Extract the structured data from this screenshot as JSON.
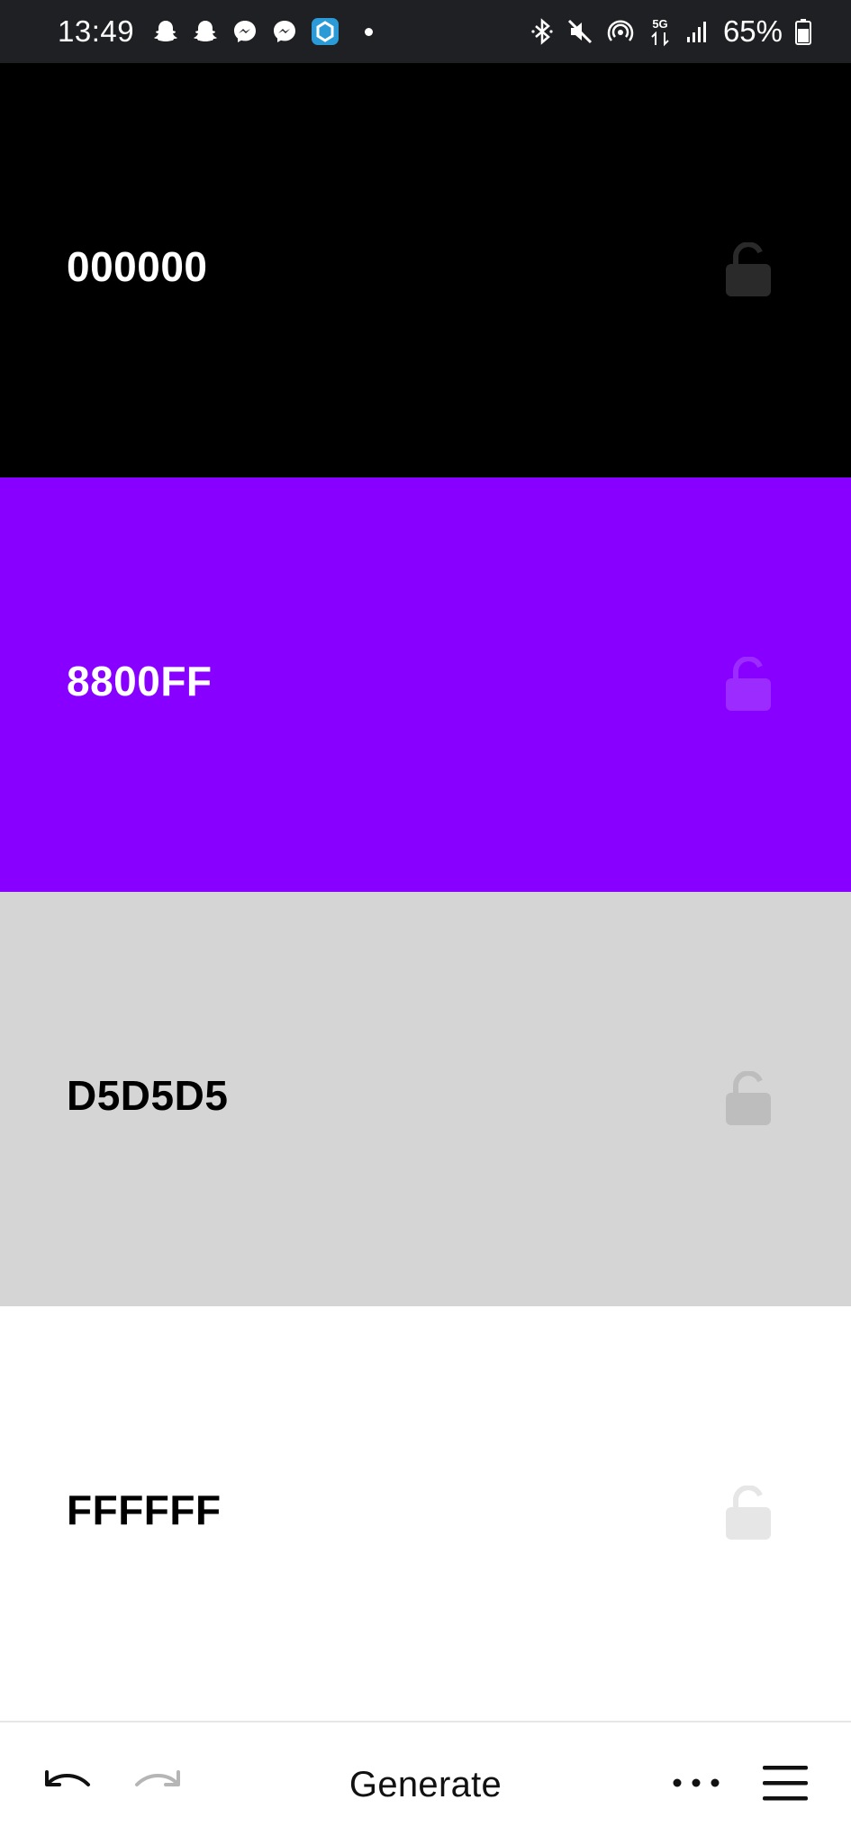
{
  "status_bar": {
    "time": "13:49",
    "left_icons": [
      "snapchat-icon",
      "snapchat-icon",
      "messenger-icon",
      "messenger-icon",
      "app-badge-icon",
      "dot-icon"
    ],
    "right_icons": [
      "bluetooth-icon",
      "mute-icon",
      "hotspot-icon",
      "5g-icon",
      "signal-icon",
      "battery-icon"
    ],
    "network_label": "5G",
    "battery": "65%"
  },
  "palette": {
    "swatches": [
      {
        "hex": "000000",
        "background": "#000000",
        "text_color": "#ffffff",
        "lock_color": "#2a2a2a",
        "locked": false
      },
      {
        "hex": "8800FF",
        "background": "#8800ff",
        "text_color": "#ffffff",
        "lock_color": "#9b2bff",
        "locked": false
      },
      {
        "hex": "D5D5D5",
        "background": "#d5d5d5",
        "text_color": "#000000",
        "lock_color": "#bdbdbd",
        "locked": false
      },
      {
        "hex": "FFFFFF",
        "background": "#ffffff",
        "text_color": "#000000",
        "lock_color": "#e6e6e6",
        "locked": false
      }
    ]
  },
  "toolbar": {
    "undo_icon": "undo-icon",
    "redo_icon": "redo-icon",
    "generate_label": "Generate",
    "more_icon": "more-dots-icon",
    "menu_icon": "hamburger-menu-icon"
  }
}
